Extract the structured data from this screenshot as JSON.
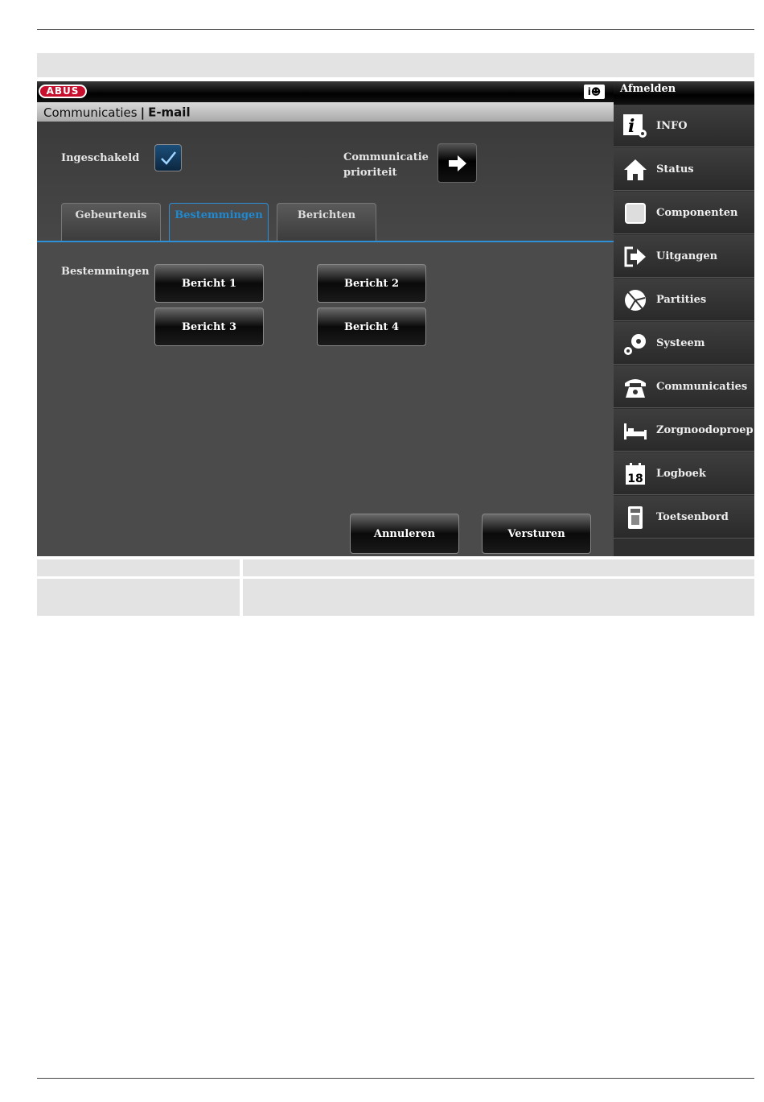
{
  "header": {
    "brand": "ABUS",
    "info_user_icon": "info-user-icon",
    "logout_label": "Afmelden"
  },
  "breadcrumb": {
    "section": "Communicaties",
    "separator": "|",
    "page": "E-mail"
  },
  "settings": {
    "enabled_label": "Ingeschakeld",
    "enabled_checked": true,
    "priority_label_line1": "Communicatie",
    "priority_label_line2": "prioriteit"
  },
  "tabs": [
    {
      "label": "Gebeurtenis",
      "active": false
    },
    {
      "label": "Bestemmingen",
      "active": true
    },
    {
      "label": "Berichten",
      "active": false
    }
  ],
  "destinations": {
    "label": "Bestemmingen",
    "buttons": [
      "Bericht 1",
      "Bericht 2",
      "Bericht 3",
      "Bericht 4"
    ]
  },
  "actions": {
    "cancel_label": "Annuleren",
    "send_label": "Versturen"
  },
  "sidebar": {
    "items": [
      {
        "label": "INFO",
        "icon": "info-gear-icon"
      },
      {
        "label": "Status",
        "icon": "house-icon"
      },
      {
        "label": "Componenten",
        "icon": "square-icon"
      },
      {
        "label": "Uitgangen",
        "icon": "exit-arrow-icon"
      },
      {
        "label": "Partities",
        "icon": "pie-partition-icon"
      },
      {
        "label": "Systeem",
        "icon": "gears-icon"
      },
      {
        "label": "Communicaties",
        "icon": "telephone-icon"
      },
      {
        "label": "Zorgnoodoproep",
        "icon": "bed-icon"
      },
      {
        "label": "Logboek",
        "icon": "calendar-icon",
        "day": "18"
      },
      {
        "label": "Toetsenbord",
        "icon": "keypad-icon"
      }
    ]
  },
  "colors": {
    "accent": "#2d8fd6",
    "panel": "#4b4b4b",
    "brand_red": "#c8102e"
  }
}
